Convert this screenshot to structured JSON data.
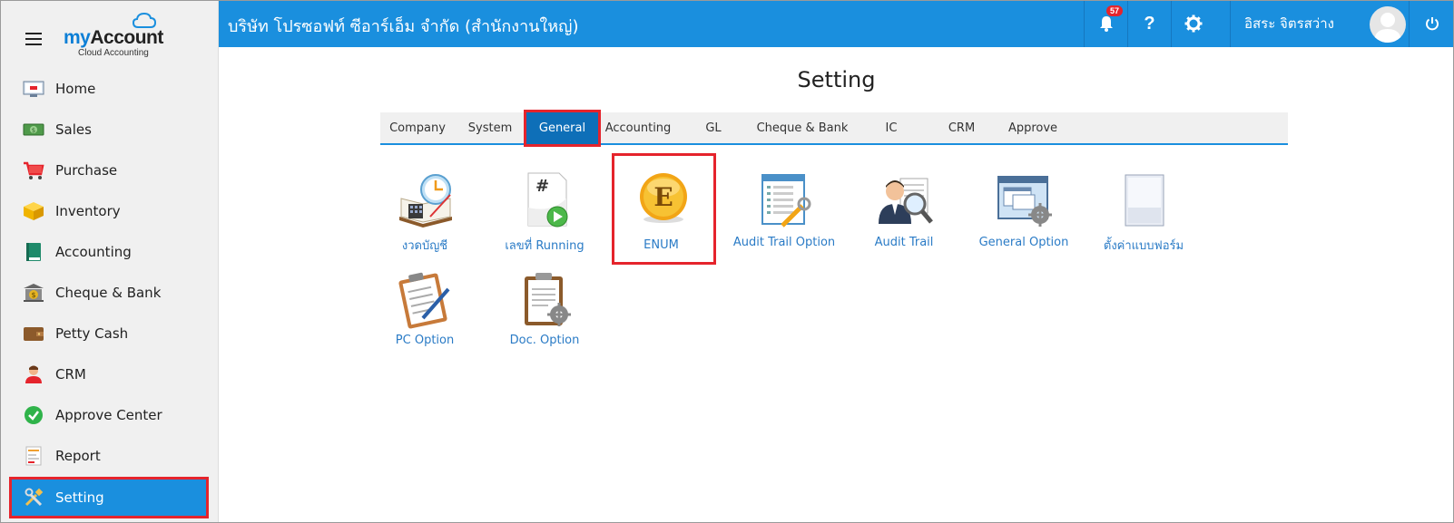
{
  "sidebar": {
    "logo": {
      "brand_part1": "my",
      "brand_part2": "Account",
      "tagline": "Cloud Accounting"
    },
    "items": [
      {
        "label": "Home",
        "icon": "home-icon"
      },
      {
        "label": "Sales",
        "icon": "money-icon"
      },
      {
        "label": "Purchase",
        "icon": "cart-icon"
      },
      {
        "label": "Inventory",
        "icon": "box-icon"
      },
      {
        "label": "Accounting",
        "icon": "book-icon"
      },
      {
        "label": "Cheque & Bank",
        "icon": "bank-icon"
      },
      {
        "label": "Petty Cash",
        "icon": "wallet-icon"
      },
      {
        "label": "CRM",
        "icon": "people-icon"
      },
      {
        "label": "Approve Center",
        "icon": "check-circle-icon"
      },
      {
        "label": "Report",
        "icon": "report-icon"
      },
      {
        "label": "Setting",
        "icon": "tools-icon",
        "active": true
      }
    ]
  },
  "header": {
    "company": "บริษัท โปรซอฟท์ ซีอาร์เอ็ม จำกัด (สำนักงานใหญ่)",
    "notification_count": "57",
    "help_glyph": "?",
    "username": "อิสระ จิตรสว่าง"
  },
  "main": {
    "title": "Setting",
    "tabs": [
      {
        "label": "Company"
      },
      {
        "label": "System"
      },
      {
        "label": "General",
        "active": true
      },
      {
        "label": "Accounting"
      },
      {
        "label": "GL"
      },
      {
        "label": "Cheque & Bank"
      },
      {
        "label": "IC"
      },
      {
        "label": "CRM"
      },
      {
        "label": "Approve"
      }
    ],
    "tiles": [
      {
        "label": "งวดบัญชี",
        "icon": "calendar-clock-icon"
      },
      {
        "label": "เลขที่ Running",
        "icon": "document-number-icon"
      },
      {
        "label": "ENUM",
        "icon": "enum-coin-icon",
        "selected": true
      },
      {
        "label": "Audit Trail Option",
        "icon": "audit-option-icon"
      },
      {
        "label": "Audit Trail",
        "icon": "audit-trail-icon"
      },
      {
        "label": "General Option",
        "icon": "window-gear-icon"
      },
      {
        "label": "ตั้งค่าแบบฟอร์ม",
        "icon": "form-template-icon"
      },
      {
        "label": "PC Option",
        "icon": "clipboard-pen-icon"
      },
      {
        "label": "Doc. Option",
        "icon": "clipboard-gear-icon"
      }
    ]
  },
  "colors": {
    "accent": "#1a8fde",
    "highlight": "#e5242c",
    "active_tab": "#0e6fb8"
  }
}
